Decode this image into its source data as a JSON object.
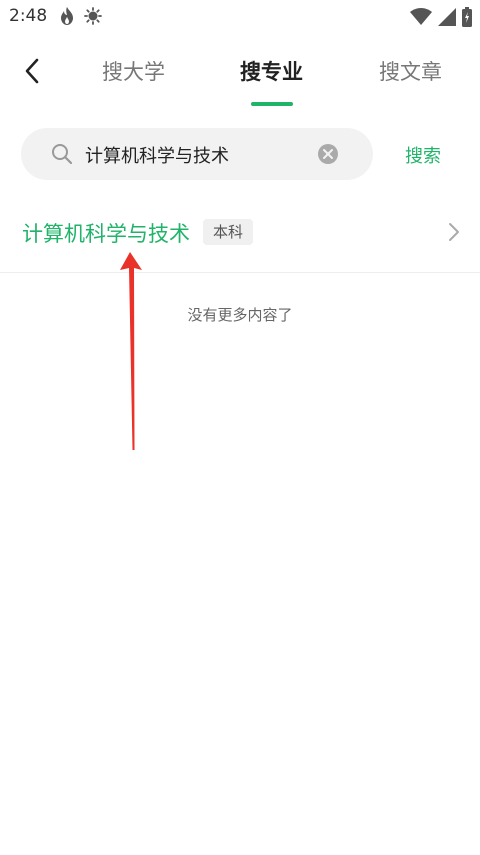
{
  "status_bar": {
    "time": "2:48",
    "icons_left": [
      "flame-icon",
      "brightness-icon"
    ],
    "icons_right": [
      "wifi-icon",
      "signal-icon",
      "battery-icon"
    ]
  },
  "nav": {
    "tabs": [
      {
        "label": "搜大学",
        "active": false
      },
      {
        "label": "搜专业",
        "active": true
      },
      {
        "label": "搜文章",
        "active": false
      }
    ],
    "accent_color": "#20b36a"
  },
  "search": {
    "value": "计算机科学与技术",
    "button_label": "搜索"
  },
  "results": [
    {
      "title": "计算机科学与技术",
      "badge": "本科"
    }
  ],
  "end_message": "没有更多内容了",
  "annotation": {
    "color": "#e8322a",
    "shape": "arrow"
  }
}
